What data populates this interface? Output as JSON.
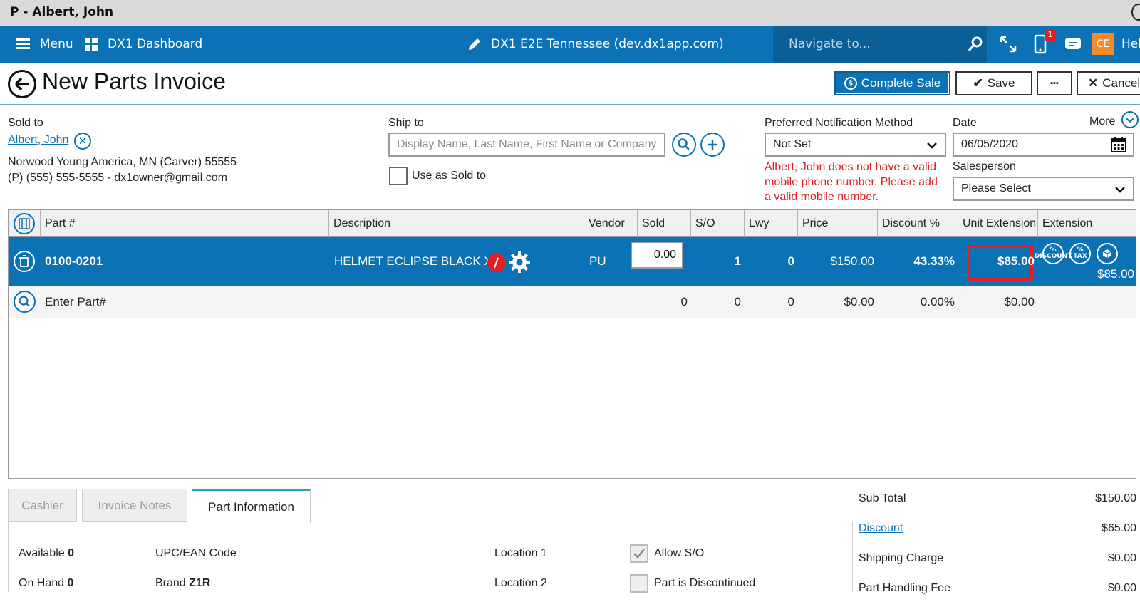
{
  "window": {
    "title": "P - Albert, John"
  },
  "nav": {
    "menu": "Menu",
    "dashboard": "DX1 Dashboard",
    "site": "DX1 E2E Tennessee (dev.dx1app.com)",
    "search_placeholder": "Navigate to...",
    "notification_count": "1",
    "user_initials": "CE",
    "help": "Hel"
  },
  "header": {
    "title": "New Parts Invoice",
    "complete_sale": "Complete Sale",
    "save": "Save",
    "more_dots": "▪▪▪",
    "cancel": "Cancel"
  },
  "customer": {
    "sold_to_label": "Sold to",
    "name": "Albert, John",
    "address": "Norwood Young America, MN (Carver) 55555",
    "contact": "(P) (555) 555-5555 - dx1owner@gmail.com"
  },
  "ship_to": {
    "label": "Ship to",
    "placeholder": "Display Name, Last Name, First Name or Company",
    "use_as_sold_to": "Use as Sold to"
  },
  "notification": {
    "label": "Preferred Notification Method",
    "value": "Not Set",
    "error": [
      "Albert, John does not have a valid",
      "mobile phone number. Please add",
      "a valid mobile number."
    ]
  },
  "date": {
    "label": "Date",
    "value": "06/05/2020",
    "more": "More"
  },
  "salesperson": {
    "label": "Salesperson",
    "value": "Please Select"
  },
  "grid": {
    "columns": [
      "Part #",
      "Description",
      "Vendor",
      "Sold",
      "S/O",
      "Lwy",
      "Price",
      "Discount %",
      "Unit Extension",
      "Extension"
    ],
    "rows": [
      {
        "part": "0100-0201",
        "description": "HELMET ECLIPSE BLACK XL",
        "vendor": "PU",
        "sold": "0.00",
        "so": "1",
        "lwy": "0",
        "price": "$150.00",
        "discount": "43.33%",
        "unit_ext": "$85.00",
        "extension": "$85.00"
      }
    ],
    "entry": {
      "placeholder": "Enter Part#",
      "sold": "0",
      "so": "0",
      "lwy": "0",
      "price": "$0.00",
      "discount": "0.00%",
      "unit_ext": "$0.00"
    },
    "row_icons": {
      "discount": "% DISCOUNT",
      "tax": "% TAX"
    }
  },
  "tabs": [
    "Cashier",
    "Invoice Notes",
    "Part Information"
  ],
  "part_info": {
    "available_label": "Available",
    "available": "0",
    "on_hand_label": "On Hand",
    "on_hand": "0",
    "upc_label": "UPC/EAN Code",
    "brand_label": "Brand",
    "brand": "Z1R",
    "location1": "Location 1",
    "location2": "Location 2",
    "allow_so": "Allow S/O",
    "discontinued": "Part is Discontinued"
  },
  "summary": {
    "subtotal_label": "Sub Total",
    "subtotal": "$150.00",
    "discount_label": "Discount",
    "discount": "$65.00",
    "shipping_label": "Shipping Charge",
    "shipping": "$0.00",
    "handling_label": "Part Handling Fee",
    "handling": "$0.00"
  },
  "colors": {
    "primary": "#0b72b5",
    "error": "#e02020",
    "highlight": "#e31e24",
    "avatar": "#f38b2a"
  }
}
